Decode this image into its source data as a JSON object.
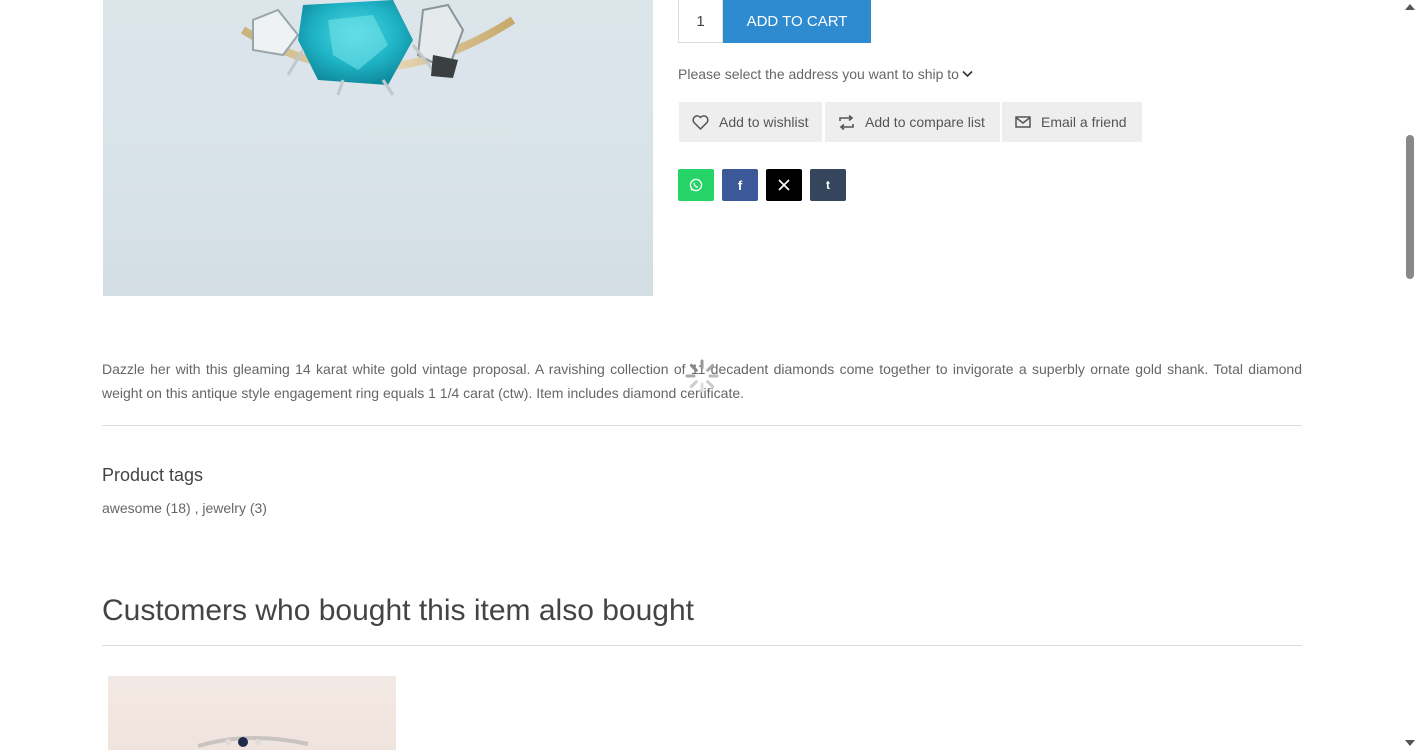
{
  "cart": {
    "quantity": "1",
    "add_to_cart_label": "ADD TO CART"
  },
  "shipping": {
    "prompt": "Please select the address you want to ship to"
  },
  "actions": {
    "wishlist_label": "Add to wishlist",
    "compare_label": "Add to compare list",
    "email_label": "Email a friend"
  },
  "share": {
    "icons": [
      "whatsapp-icon",
      "facebook-icon",
      "x-icon",
      "tumblr-icon"
    ],
    "colors": {
      "whatsapp": "#25d366",
      "facebook": "#3b5998",
      "x": "#000000",
      "tumblr": "#35465c"
    }
  },
  "description": "Dazzle her with this gleaming 14 karat white gold vintage proposal. A ravishing collection of 11 decadent diamonds come together to invigorate a superbly ornate gold shank. Total diamond weight on this antique style engagement ring equals 1 1/4 carat (ctw). Item includes diamond certificate.",
  "tags": {
    "title": "Product tags",
    "items": [
      {
        "label": "awesome (18)"
      },
      {
        "label": "jewelry (3)"
      }
    ],
    "separator": " , "
  },
  "also_bought": {
    "title": "Customers who bought this item also bought"
  },
  "theme": {
    "accent": "#2e8bd0",
    "button_bg": "#eeeeee"
  }
}
